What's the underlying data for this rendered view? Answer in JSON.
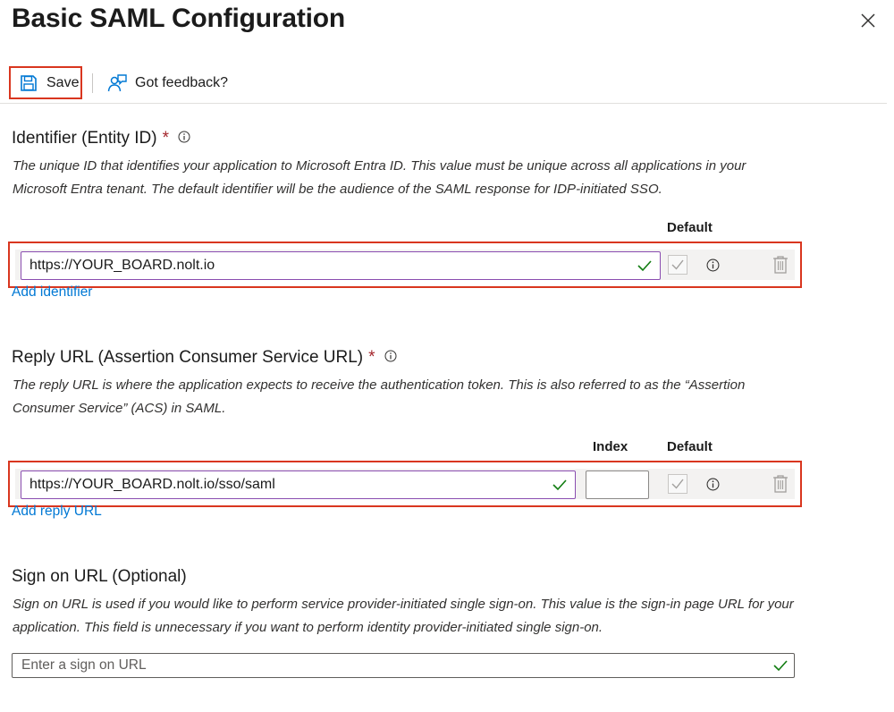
{
  "header": {
    "title": "Basic SAML Configuration"
  },
  "toolbar": {
    "save_label": "Save",
    "feedback_label": "Got feedback?"
  },
  "identifier": {
    "title": "Identifier (Entity ID)",
    "required_mark": "*",
    "description": "The unique ID that identifies your application to Microsoft Entra ID. This value must be unique across all applications in your Microsoft Entra tenant. The default identifier will be the audience of the SAML response for IDP-initiated SSO.",
    "col_default": "Default",
    "value": "https://YOUR_BOARD.nolt.io",
    "add_link": "Add identifier"
  },
  "reply_url": {
    "title": "Reply URL (Assertion Consumer Service URL)",
    "required_mark": "*",
    "description": "The reply URL is where the application expects to receive the authentication token. This is also referred to as the “Assertion Consumer Service” (ACS) in SAML.",
    "col_index": "Index",
    "col_default": "Default",
    "value": "https://YOUR_BOARD.nolt.io/sso/saml",
    "index_value": "",
    "add_link": "Add reply URL"
  },
  "sign_on": {
    "title": "Sign on URL (Optional)",
    "description": "Sign on URL is used if you would like to perform service provider-initiated single sign-on. This value is the sign-in page URL for your application. This field is unnecessary if you want to perform identity provider-initiated single sign-on.",
    "placeholder": "Enter a sign on URL",
    "value": ""
  },
  "colors": {
    "accent": "#0078d4",
    "highlight": "#d9361f",
    "valid": "#107c10",
    "required": "#a4262c"
  },
  "icons": [
    "close-icon",
    "save-icon",
    "feedback-icon",
    "info-icon",
    "checkmark-icon",
    "checkbox-icon",
    "trash-icon"
  ]
}
